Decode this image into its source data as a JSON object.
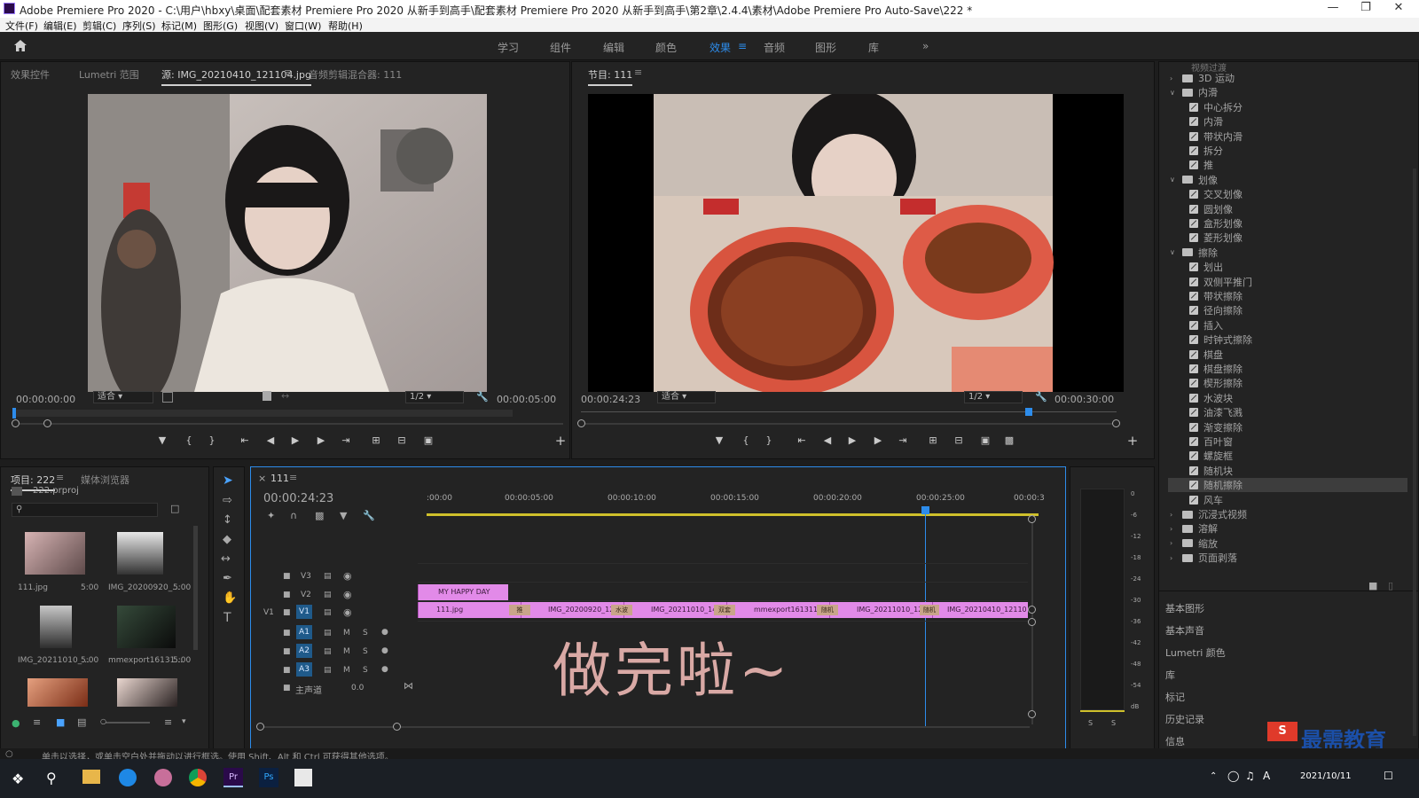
{
  "window": {
    "title": "Adobe Premiere Pro 2020 - C:\\用户\\hbxy\\桌面\\配套素材 Premiere Pro 2020 从新手到高手\\配套素材 Premiere Pro 2020 从新手到高手\\第2章\\2.4.4\\素材\\Adobe Premiere Pro Auto-Save\\222 *"
  },
  "menu": [
    "文件(F)",
    "编辑(E)",
    "剪辑(C)",
    "序列(S)",
    "标记(M)",
    "图形(G)",
    "视图(V)",
    "窗口(W)",
    "帮助(H)"
  ],
  "workspaces": {
    "items": [
      "学习",
      "组件",
      "编辑",
      "颜色",
      "效果",
      "音频",
      "图形",
      "库"
    ],
    "active": "效果",
    "more": "»"
  },
  "source_panel": {
    "tabs": [
      "效果控件",
      "Lumetri 范围",
      "源: IMG_20210410_121104.jpg",
      "音频剪辑混合器: 111"
    ],
    "active_tab": "源: IMG_20210410_121104.jpg",
    "timecode": "00:00:00:00",
    "fit": "适合",
    "resolution": "1/2",
    "duration": "00:00:05:00"
  },
  "program_panel": {
    "title": "节目: 111",
    "timecode": "00:00:24:23",
    "fit": "适合",
    "resolution": "1/2",
    "duration": "00:00:30:00",
    "playhead_fraction": 0.83
  },
  "project_panel": {
    "tabs": [
      "项目: 222",
      "媒体浏览器"
    ],
    "file": "222.prproj",
    "search_placeholder": "",
    "items": [
      {
        "name": "111.jpg",
        "dur": "5:00"
      },
      {
        "name": "IMG_20200920_...",
        "dur": "5:00"
      },
      {
        "name": "IMG_20211010_...",
        "dur": "5:00"
      },
      {
        "name": "mmexport16131...",
        "dur": "5:00"
      },
      {
        "name": "",
        "dur": ""
      },
      {
        "name": "",
        "dur": ""
      }
    ]
  },
  "timeline": {
    "sequence": "111",
    "timecode": "00:00:24:23",
    "ruler": [
      ":00:00",
      "00:00:05:00",
      "00:00:10:00",
      "00:00:15:00",
      "00:00:20:00",
      "00:00:25:00",
      "00:00:3"
    ],
    "tracks": {
      "video": [
        "V3",
        "V2",
        "V1"
      ],
      "audio": [
        "A1",
        "A2",
        "A3"
      ],
      "master_label": "主声道",
      "master_value": "0.0",
      "v1_source": "V1",
      "mute": "M",
      "solo": "S"
    },
    "v2_clip": "MY HAPPY DAY",
    "v1_clips": [
      "111.jpg",
      "IMG_20200920_12",
      "IMG_20211010_14",
      "mmexport1613115",
      "IMG_20211010_122",
      "IMG_20210410_12110"
    ],
    "transitions": [
      "推",
      "水波",
      "双套",
      "随机",
      "随机"
    ],
    "overlay_text": "做完啦~"
  },
  "meter": {
    "scale": [
      "0",
      "-6",
      "-12",
      "-18",
      "-24",
      "-30",
      "-36",
      "-42",
      "-48",
      "-54",
      "dB"
    ],
    "solo_labels": [
      "S",
      "S"
    ]
  },
  "effects": {
    "top_partial": "视频过渡",
    "tree": [
      {
        "level": 0,
        "type": "folder",
        "label": "3D 运动",
        "open": false
      },
      {
        "level": 0,
        "type": "folder",
        "label": "内滑",
        "open": true
      },
      {
        "level": 1,
        "type": "fx",
        "label": "中心拆分"
      },
      {
        "level": 1,
        "type": "fx",
        "label": "内滑"
      },
      {
        "level": 1,
        "type": "fx",
        "label": "带状内滑"
      },
      {
        "level": 1,
        "type": "fx",
        "label": "拆分"
      },
      {
        "level": 1,
        "type": "fx",
        "label": "推"
      },
      {
        "level": 0,
        "type": "folder",
        "label": "划像",
        "open": true
      },
      {
        "level": 1,
        "type": "fx",
        "label": "交叉划像"
      },
      {
        "level": 1,
        "type": "fx",
        "label": "圆划像"
      },
      {
        "level": 1,
        "type": "fx",
        "label": "盒形划像"
      },
      {
        "level": 1,
        "type": "fx",
        "label": "菱形划像"
      },
      {
        "level": 0,
        "type": "folder",
        "label": "擦除",
        "open": true
      },
      {
        "level": 1,
        "type": "fx",
        "label": "划出"
      },
      {
        "level": 1,
        "type": "fx",
        "label": "双侧平推门"
      },
      {
        "level": 1,
        "type": "fx",
        "label": "带状擦除"
      },
      {
        "level": 1,
        "type": "fx",
        "label": "径向擦除"
      },
      {
        "level": 1,
        "type": "fx",
        "label": "插入"
      },
      {
        "level": 1,
        "type": "fx",
        "label": "时钟式擦除"
      },
      {
        "level": 1,
        "type": "fx",
        "label": "棋盘"
      },
      {
        "level": 1,
        "type": "fx",
        "label": "棋盘擦除"
      },
      {
        "level": 1,
        "type": "fx",
        "label": "楔形擦除"
      },
      {
        "level": 1,
        "type": "fx",
        "label": "水波块"
      },
      {
        "level": 1,
        "type": "fx",
        "label": "油漆飞溅"
      },
      {
        "level": 1,
        "type": "fx",
        "label": "渐变擦除"
      },
      {
        "level": 1,
        "type": "fx",
        "label": "百叶窗"
      },
      {
        "level": 1,
        "type": "fx",
        "label": "螺旋框"
      },
      {
        "level": 1,
        "type": "fx",
        "label": "随机块"
      },
      {
        "level": 1,
        "type": "fx",
        "label": "随机擦除",
        "selected": true
      },
      {
        "level": 1,
        "type": "fx",
        "label": "风车"
      },
      {
        "level": 0,
        "type": "folder",
        "label": "沉浸式视频",
        "open": false
      },
      {
        "level": 0,
        "type": "folder",
        "label": "溶解",
        "open": false
      },
      {
        "level": 0,
        "type": "folder",
        "label": "缩放",
        "open": false
      },
      {
        "level": 0,
        "type": "folder",
        "label": "页面剥落",
        "open": false
      }
    ],
    "panels": [
      "基本图形",
      "基本声音",
      "Lumetri 颜色",
      "库",
      "标记",
      "历史记录",
      "信息"
    ]
  },
  "status_bar": "单击以选择，或单击空白处并拖动以进行框选。使用 Shift、Alt 和 Ctrl 可获得其他选项。",
  "taskbar": {
    "date": "2021/10/11",
    "watermark": "最需教育"
  },
  "colors": {
    "accent": "#2d8ceb",
    "clip": "#e28ae8",
    "playhead": "#2d8ceb",
    "overlay_text": "#d9a9a5"
  }
}
